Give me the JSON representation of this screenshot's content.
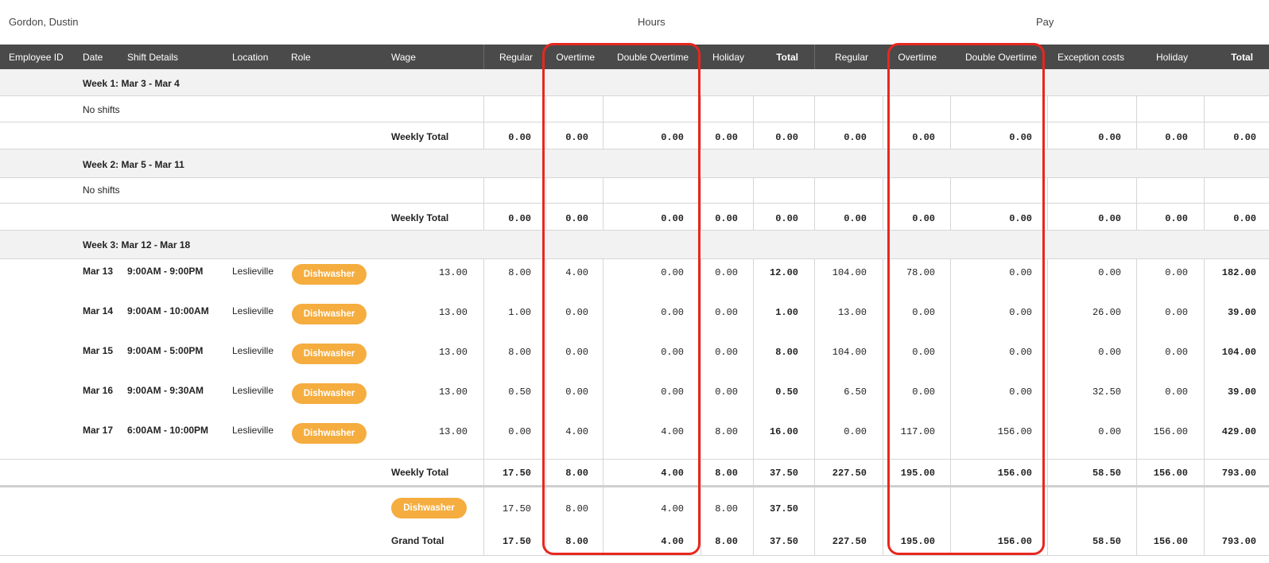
{
  "employee_name": "Gordon, Dustin",
  "groups": {
    "hours": "Hours",
    "pay": "Pay"
  },
  "columns": {
    "employee_id": "Employee ID",
    "date": "Date",
    "shift_details": "Shift Details",
    "location": "Location",
    "role": "Role",
    "wage": "Wage",
    "h_regular": "Regular",
    "h_overtime": "Overtime",
    "h_double_overtime": "Double Overtime",
    "h_holiday": "Holiday",
    "h_total": "Total",
    "p_regular": "Regular",
    "p_overtime": "Overtime",
    "p_double_overtime": "Double Overtime",
    "p_exception_costs": "Exception costs",
    "p_holiday": "Holiday",
    "p_total": "Total"
  },
  "weeks": [
    {
      "title": "Week 1: Mar 3 - Mar 4",
      "no_shifts": "No shifts",
      "total_label": "Weekly Total",
      "totals": [
        "0.00",
        "0.00",
        "0.00",
        "0.00",
        "0.00",
        "0.00",
        "0.00",
        "0.00",
        "0.00",
        "0.00",
        "0.00"
      ]
    },
    {
      "title": "Week 2: Mar 5 - Mar 11",
      "no_shifts": "No shifts",
      "total_label": "Weekly Total",
      "totals": [
        "0.00",
        "0.00",
        "0.00",
        "0.00",
        "0.00",
        "0.00",
        "0.00",
        "0.00",
        "0.00",
        "0.00",
        "0.00"
      ]
    },
    {
      "title": "Week 3: Mar 12 - Mar 18",
      "total_label": "Weekly Total",
      "shifts": [
        {
          "date": "Mar 13",
          "time": "9:00AM - 9:00PM",
          "location": "Leslieville",
          "role": "Dishwasher",
          "wage": "13.00",
          "values": [
            "8.00",
            "4.00",
            "0.00",
            "0.00",
            "12.00",
            "104.00",
            "78.00",
            "0.00",
            "0.00",
            "0.00",
            "182.00"
          ]
        },
        {
          "date": "Mar 14",
          "time": "9:00AM - 10:00AM",
          "location": "Leslieville",
          "role": "Dishwasher",
          "wage": "13.00",
          "values": [
            "1.00",
            "0.00",
            "0.00",
            "0.00",
            "1.00",
            "13.00",
            "0.00",
            "0.00",
            "26.00",
            "0.00",
            "39.00"
          ]
        },
        {
          "date": "Mar 15",
          "time": "9:00AM - 5:00PM",
          "location": "Leslieville",
          "role": "Dishwasher",
          "wage": "13.00",
          "values": [
            "8.00",
            "0.00",
            "0.00",
            "0.00",
            "8.00",
            "104.00",
            "0.00",
            "0.00",
            "0.00",
            "0.00",
            "104.00"
          ]
        },
        {
          "date": "Mar 16",
          "time": "9:00AM - 9:30AM",
          "location": "Leslieville",
          "role": "Dishwasher",
          "wage": "13.00",
          "values": [
            "0.50",
            "0.00",
            "0.00",
            "0.00",
            "0.50",
            "6.50",
            "0.00",
            "0.00",
            "32.50",
            "0.00",
            "39.00"
          ]
        },
        {
          "date": "Mar 17",
          "time": "6:00AM - 10:00PM",
          "location": "Leslieville",
          "role": "Dishwasher",
          "wage": "13.00",
          "values": [
            "0.00",
            "4.00",
            "4.00",
            "8.00",
            "16.00",
            "0.00",
            "117.00",
            "156.00",
            "0.00",
            "156.00",
            "429.00"
          ]
        }
      ],
      "totals": [
        "17.50",
        "8.00",
        "4.00",
        "8.00",
        "37.50",
        "227.50",
        "195.00",
        "156.00",
        "58.50",
        "156.00",
        "793.00"
      ]
    }
  ],
  "role_summary": {
    "role": "Dishwasher",
    "values": [
      "17.50",
      "8.00",
      "4.00",
      "8.00",
      "37.50"
    ]
  },
  "grand_total": {
    "label": "Grand Total",
    "values": [
      "17.50",
      "8.00",
      "4.00",
      "8.00",
      "37.50",
      "227.50",
      "195.00",
      "156.00",
      "58.50",
      "156.00",
      "793.00"
    ]
  },
  "colors": {
    "header_bg": "#4a4a4a",
    "role_pill": "#f5ad3f",
    "highlight": "#e8271f",
    "week_band": "#f2f2f2"
  }
}
